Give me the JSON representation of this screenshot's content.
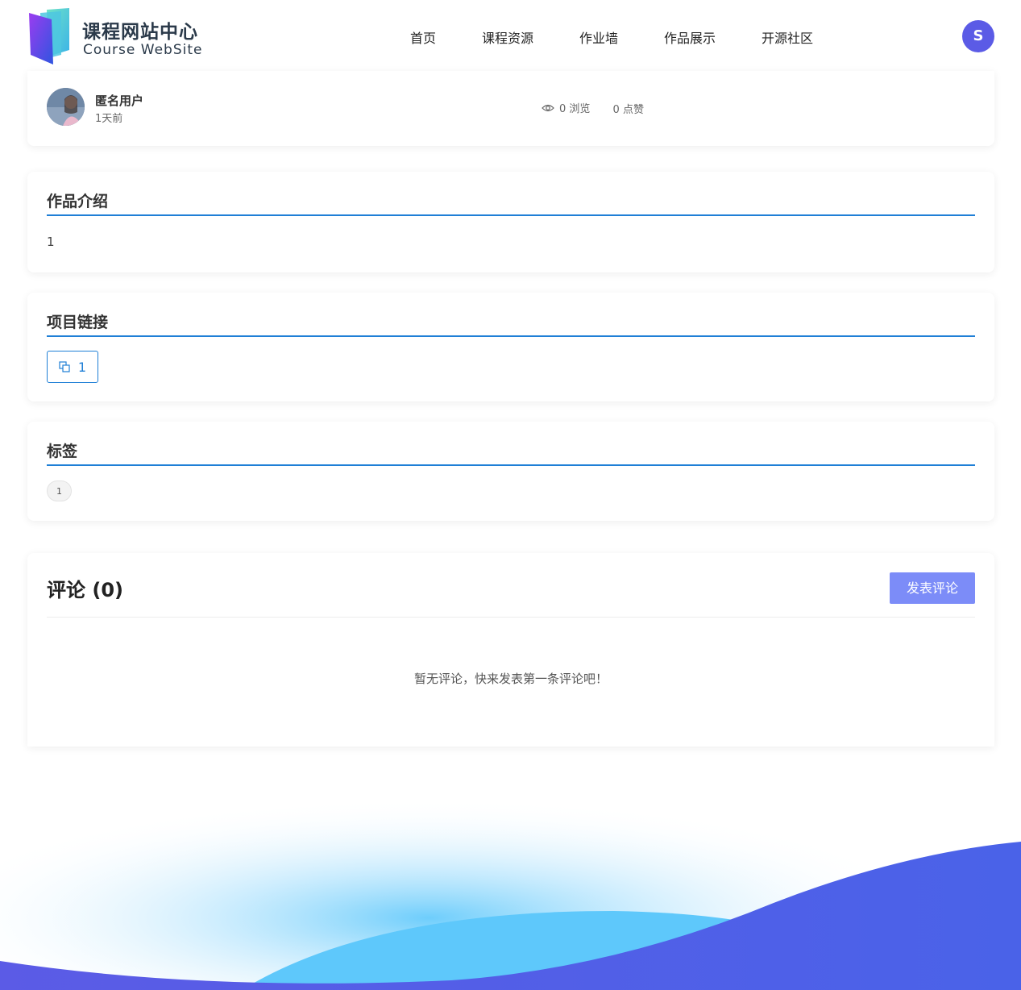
{
  "brand": {
    "title_cn": "课程网站中心",
    "title_en": "Course WebSite"
  },
  "nav": [
    {
      "label": "首页"
    },
    {
      "label": "课程资源"
    },
    {
      "label": "作业墙"
    },
    {
      "label": "作品展示"
    },
    {
      "label": "开源社区"
    }
  ],
  "user": {
    "initial": "S"
  },
  "author": {
    "name": "匿名用户",
    "time": "1天前",
    "views_label": "0 浏览",
    "likes_label": "0 点赞"
  },
  "intro": {
    "title": "作品介绍",
    "text": "1"
  },
  "links": {
    "title": "项目链接",
    "items": [
      {
        "label": "1"
      }
    ]
  },
  "tags": {
    "title": "标签",
    "items": [
      "1"
    ]
  },
  "comments": {
    "title": "评论 (0)",
    "post_label": "发表评论",
    "empty_text": "暂无评论，快来发表第一条评论吧！"
  },
  "colors": {
    "accent": "#1f7fd6",
    "avatar_bg": "#5b5be6",
    "post_button": "#7c8cf8",
    "wave_primary": "#4a5fe6",
    "wave_light": "#5ec8fb"
  },
  "icons": {
    "views": "eye-icon",
    "link": "copy-link-icon"
  }
}
